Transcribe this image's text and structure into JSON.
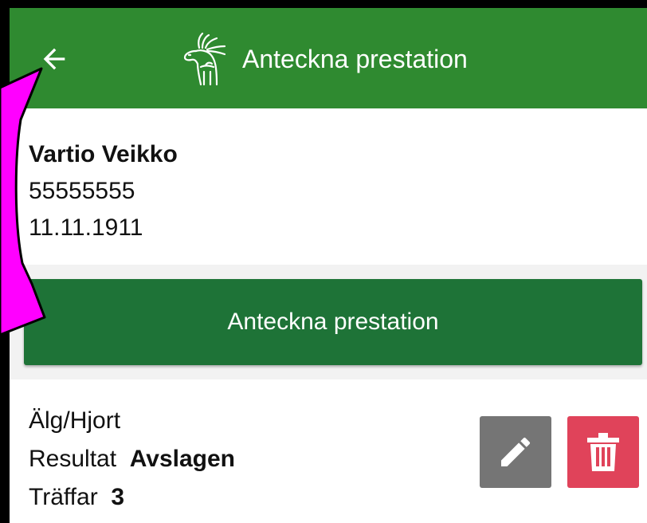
{
  "header": {
    "title": "Anteckna prestation",
    "back_icon": "arrow-left-icon",
    "logo_icon": "moose-logo-icon",
    "background": "#2f8a30"
  },
  "person": {
    "name": "Vartio Veikko",
    "id": "55555555",
    "birth_date": "11.11.1911"
  },
  "actions": {
    "record_label": "Anteckna prestation",
    "record_color": "#1e7337"
  },
  "result": {
    "category": "Älg/Hjort",
    "result_label": "Resultat",
    "result_value": "Avslagen",
    "hits_label": "Träffar",
    "hits_value": "3",
    "edit_icon": "pencil-icon",
    "delete_icon": "trash-icon",
    "edit_color": "#757575",
    "delete_color": "#e0435a"
  },
  "annotation": {
    "color": "#ff00ff",
    "icon": "magenta-arrow-annotation"
  }
}
